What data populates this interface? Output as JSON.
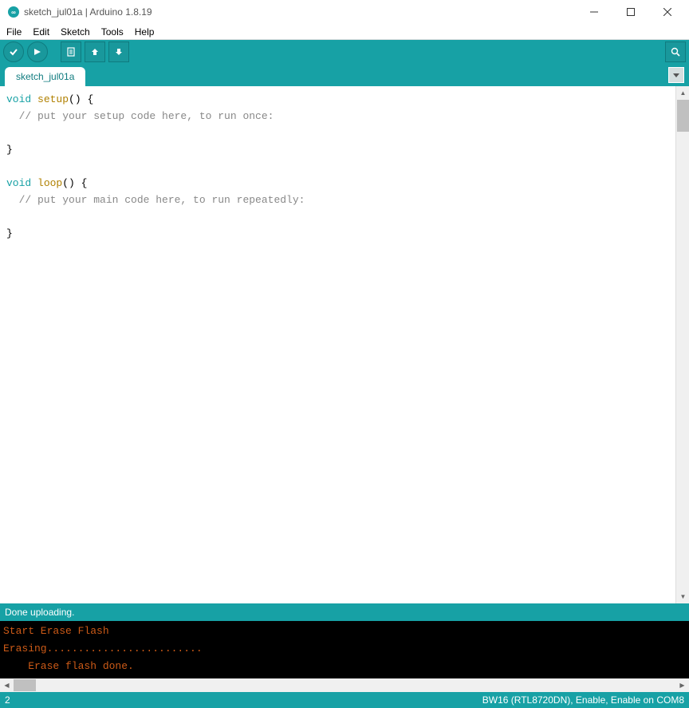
{
  "window": {
    "title": "sketch_jul01a | Arduino 1.8.19"
  },
  "menu": {
    "file": "File",
    "edit": "Edit",
    "sketch": "Sketch",
    "tools": "Tools",
    "help": "Help"
  },
  "tabs": {
    "active": "sketch_jul01a"
  },
  "code": {
    "l1_void": "void",
    "l1_fn": "setup",
    "l1_rest": "() {",
    "l2_comment": "  // put your setup code here, to run once:",
    "l3": "",
    "l4_brace": "}",
    "l5": "",
    "l6_void": "void",
    "l6_fn": "loop",
    "l6_rest": "() {",
    "l7_comment": "  // put your main code here, to run repeatedly:",
    "l8": "",
    "l9_brace": "}"
  },
  "status": {
    "message": "Done uploading."
  },
  "console": {
    "line1": "Start Erase Flash",
    "line2": "Erasing.........................",
    "line3": "    Erase flash done."
  },
  "bottom": {
    "line": "2",
    "board": "BW16 (RTL8720DN), Enable, Enable on COM8"
  }
}
